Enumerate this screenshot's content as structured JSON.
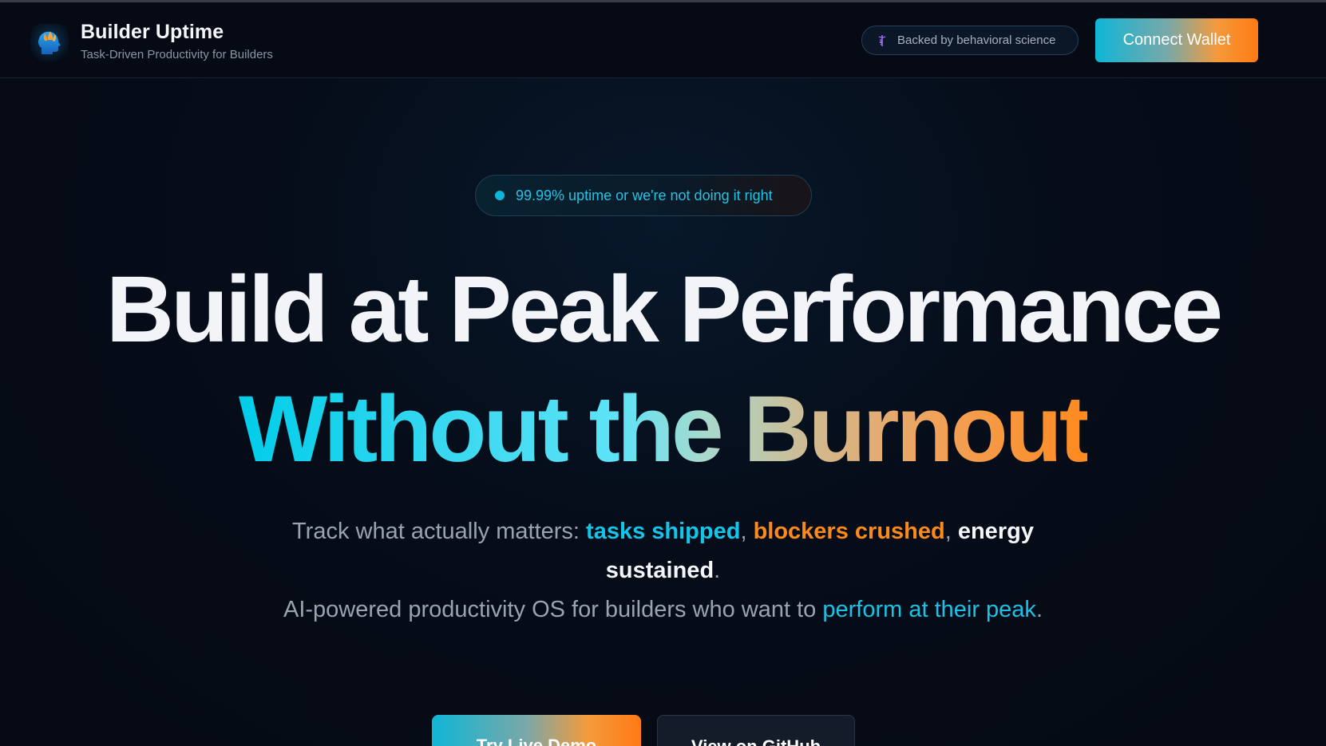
{
  "header": {
    "brand_title": "Builder Uptime",
    "brand_subtitle": "Task-Driven Productivity for Builders",
    "science_badge": "Backed by behavioral science",
    "connect_button": "Connect Wallet",
    "logo_icon": "brain-head-icon",
    "badge_icon": "caduceus-icon"
  },
  "hero": {
    "pill_text": "99.99% uptime or we're not doing it right",
    "headline_line1": "Build at Peak Performance",
    "headline_line2": "Without the Burnout",
    "sub_intro": "Track what actually matters: ",
    "sub_tasks": "tasks shipped",
    "sub_comma1": ", ",
    "sub_blockers": "blockers crushed",
    "sub_comma2": ", ",
    "sub_energy": "energy sustained",
    "sub_period1": ".",
    "sub_line2_intro": "AI-powered productivity OS for builders who want to ",
    "sub_peak": "perform at their peak",
    "sub_period2": "."
  },
  "actions": {
    "demo_button": "Try Live Demo",
    "github_button": "View on GitHub"
  },
  "colors": {
    "accent_cyan": "#12c6ea",
    "accent_orange": "#fb8a1c",
    "background": "#050a14"
  }
}
